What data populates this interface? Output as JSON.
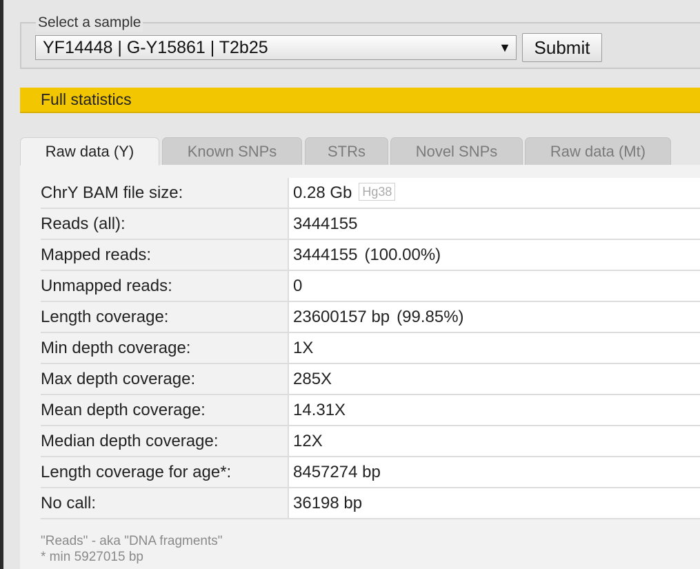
{
  "sample_selector": {
    "legend": "Select a sample",
    "selected": "YF14448 | G-Y15861 | T2b25",
    "arrow_icon": "triangle-down-icon",
    "submit_label": "Submit"
  },
  "section": {
    "title": "Full statistics",
    "accent_color": "#f2c600"
  },
  "tabs": [
    {
      "label": "Raw data (Y)",
      "active": true
    },
    {
      "label": "Known SNPs",
      "active": false
    },
    {
      "label": "STRs",
      "active": false
    },
    {
      "label": "Novel SNPs",
      "active": false
    },
    {
      "label": "Raw data (Mt)",
      "active": false
    }
  ],
  "stats": [
    {
      "label": "ChrY BAM file size:",
      "value": "0.28 Gb",
      "badge": "Hg38"
    },
    {
      "label": "Reads (all):",
      "value": "3444155"
    },
    {
      "label": "Mapped reads:",
      "value": "3444155",
      "extra": "(100.00%)"
    },
    {
      "label": "Unmapped reads:",
      "value": "0"
    },
    {
      "label": "Length coverage:",
      "value": "23600157 bp",
      "extra": "(99.85%)"
    },
    {
      "label": "Min depth coverage:",
      "value": "1X"
    },
    {
      "label": "Max depth coverage:",
      "value": "285X"
    },
    {
      "label": "Mean depth coverage:",
      "value": "14.31X"
    },
    {
      "label": "Median depth coverage:",
      "value": "12X"
    },
    {
      "label": "Length coverage for age*:",
      "value": "8457274 bp"
    },
    {
      "label": "No call:",
      "value": "36198 bp"
    }
  ],
  "notes": {
    "line1": "\"Reads\" - aka \"DNA fragments\"",
    "line2": "* min 5927015 bp"
  }
}
